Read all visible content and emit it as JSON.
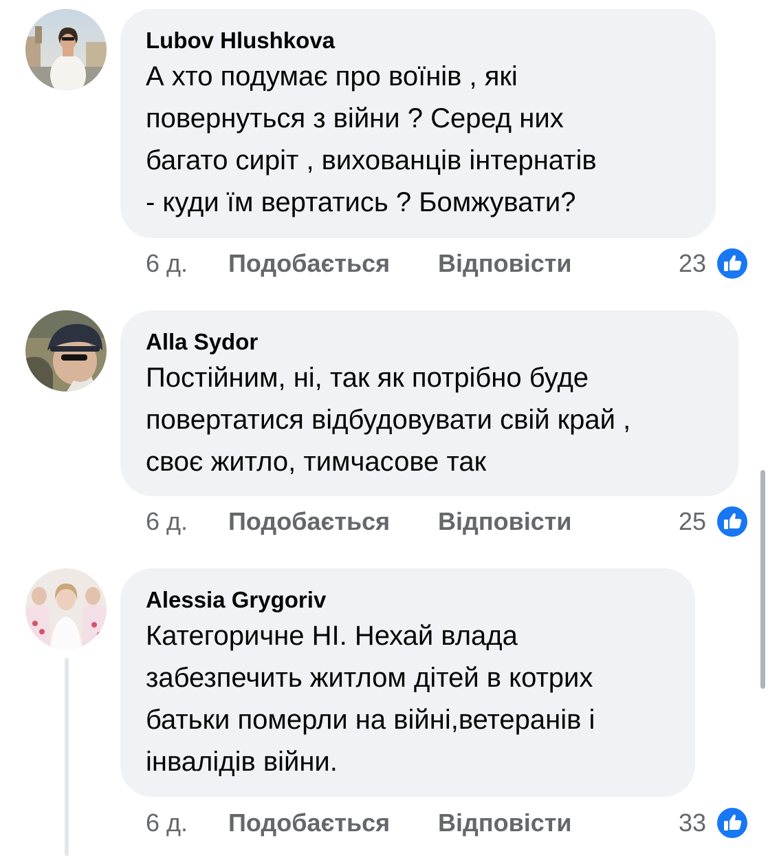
{
  "colors": {
    "bubble_bg": "#f0f2f5",
    "meta_text": "#65676b",
    "like_blue": "#1877f2"
  },
  "comments": [
    {
      "author": "Lubov Hlushkova",
      "text": "А  хто  подумає  про  воїнів , які\nповернуться  з  війни ?   Серед  них\nбагато  сиріт , вихованців  інтернатів\n-   куди  їм  вертатись ?  Бомжувати?",
      "time": "6 д.",
      "like_label": "Подобається",
      "reply_label": "Відповісти",
      "reaction_count": "23",
      "reaction_icon": "thumbs-up-icon"
    },
    {
      "author": "Alla Sydor",
      "text": "Постійним, ні, так як потрібно буде\nповертатися відбудовувати свій край ,\nсвоє житло, тимчасове так",
      "time": "6 д.",
      "like_label": "Подобається",
      "reply_label": "Відповісти",
      "reaction_count": "25",
      "reaction_icon": "thumbs-up-icon"
    },
    {
      "author": "Alessia Grygoriv",
      "text": "Категоричне НІ. Нехай влада\nзабезпечить житлом дітей в котрих\nбатьки померли на війні,ветеранів і\nінвалідів війни.",
      "time": "6 д.",
      "like_label": "Подобається",
      "reply_label": "Відповісти",
      "reaction_count": "33",
      "reaction_icon": "thumbs-up-icon"
    }
  ]
}
